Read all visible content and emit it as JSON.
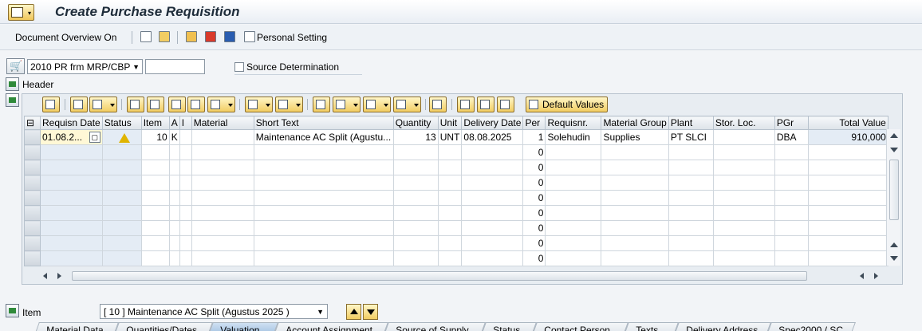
{
  "window": {
    "title": "Create Purchase Requisition"
  },
  "toolbar": {
    "document_overview": "Document Overview On",
    "personal_setting": "Personal Setting"
  },
  "header_fields": {
    "doc_type": "2010 PR frm MRP/CBP",
    "doc_number_value": "",
    "source_determination": "Source Determination",
    "header_label": "Header"
  },
  "grid": {
    "default_values_label": "Default Values",
    "columns": [
      "Requisn Date",
      "Status",
      "Item",
      "A",
      "I",
      "Material",
      "Short Text",
      "Quantity",
      "Unit",
      "Delivery Date",
      "Per",
      "Requisnr.",
      "Material Group",
      "Plant",
      "Stor. Loc.",
      "PGr",
      "Total Value"
    ],
    "rows": [
      {
        "date": "01.08.2...",
        "item": "10",
        "a": "K",
        "short_text": "Maintenance AC Split (Agustu...",
        "quantity": "13",
        "unit": "UNT",
        "delivery_date": "08.08.2025",
        "per": "1",
        "requisnr": "Solehudin",
        "matgroup": "Supplies",
        "plant": "PT SLCI",
        "pgr": "DBA",
        "total_value": "910,000"
      }
    ],
    "empty_per": [
      "0",
      "0",
      "0",
      "0",
      "0",
      "0",
      "0",
      "0"
    ]
  },
  "item_section": {
    "label": "Item",
    "selected": "[ 10 ] Maintenance AC Split (Agustus 2025 )"
  },
  "tabs": [
    "Material Data",
    "Quantities/Dates",
    "Valuation",
    "Account Assignment",
    "Source of Supply",
    "Status",
    "Contact Person",
    "Texts",
    "Delivery Address",
    "Spec2000 / SC..."
  ],
  "colors": {
    "accent": "#f2cd62",
    "header_bg": "#e8edf2",
    "active_tab": "#9fbfe0"
  }
}
